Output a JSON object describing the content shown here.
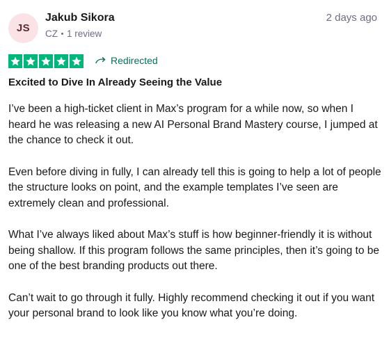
{
  "review": {
    "avatar_initials": "JS",
    "reviewer_name": "Jakub Sikora",
    "country": "CZ",
    "review_count": "1 review",
    "date": "2 days ago",
    "rating": 5,
    "star_color": "#00b67a",
    "redirect_label": "Redirected",
    "title": "Excited to Dive In Already Seeing the Value",
    "paragraphs": [
      "I’ve been a high-ticket client in Max’s program for a while now, so when I heard he was releasing a new AI Personal Brand Mastery course, I jumped at the chance to check it out.",
      "Even before diving in fully, I can already tell this is going to help a lot of people the structure looks on point, and the example templates I’ve seen are extremely clean and professional.",
      "What I’ve always liked about Max’s stuff is how beginner-friendly it is without being shallow. If this program follows the same principles, then it’s going to be one of the best branding products out there.",
      "Can’t wait to go through it fully. Highly recommend checking it out if you want your personal brand to look like you know what you’re doing."
    ]
  }
}
